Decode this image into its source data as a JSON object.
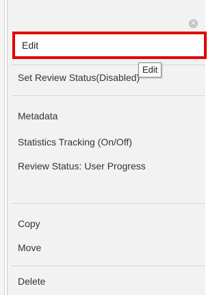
{
  "menu": {
    "items": [
      {
        "label": "Edit"
      },
      {
        "label": "Set Review Status(Disabled)"
      },
      {
        "label": "Metadata"
      },
      {
        "label": "Statistics Tracking (On/Off)"
      },
      {
        "label": "Review Status: User Progress"
      },
      {
        "label": "Copy"
      },
      {
        "label": "Move"
      },
      {
        "label": "Delete"
      }
    ],
    "close_glyph": "✕"
  },
  "tooltip": {
    "text": "Edit"
  },
  "colors": {
    "highlight_border": "#e00000",
    "menu_bg": "#f2f2f2"
  }
}
